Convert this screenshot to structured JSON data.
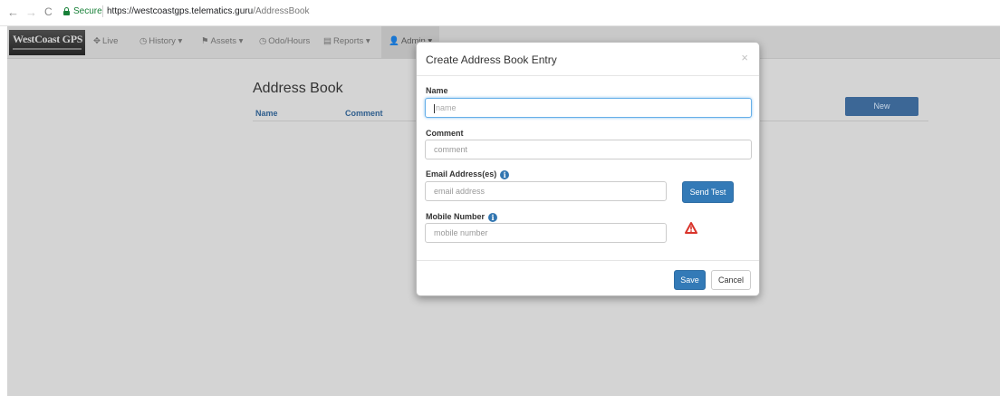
{
  "browser": {
    "back": "←",
    "forward": "→",
    "reload": "C",
    "secure_label": "Secure",
    "url_base": "https://westcoastgps.telematics.guru",
    "url_path": "/AddressBook"
  },
  "navbar": {
    "brand": "WestCoast GPS",
    "items": [
      {
        "icon": "✥",
        "label": "Live"
      },
      {
        "icon": "◷",
        "label": "History ▾"
      },
      {
        "icon": "⚑",
        "label": "Assets ▾"
      },
      {
        "icon": "◷",
        "label": "Odo/Hours"
      },
      {
        "icon": "▤",
        "label": "Reports ▾"
      },
      {
        "icon": "👤",
        "label": "Admin ▾"
      }
    ]
  },
  "page": {
    "title": "Address Book",
    "columns": [
      "Name",
      "Comment"
    ],
    "new_button": "New"
  },
  "modal": {
    "title": "Create Address Book Entry",
    "close": "×",
    "name_label": "Name",
    "name_placeholder": "name",
    "comment_label": "Comment",
    "comment_placeholder": "comment",
    "email_label": "Email Address(es)",
    "email_placeholder": "email address",
    "send_test": "Send Test",
    "mobile_label": "Mobile Number",
    "mobile_placeholder": "mobile number",
    "info_glyph": "i",
    "save": "Save",
    "cancel": "Cancel"
  },
  "colors": {
    "primary": "#337ab7",
    "warning": "#d9342b",
    "secure_green": "#188038"
  }
}
